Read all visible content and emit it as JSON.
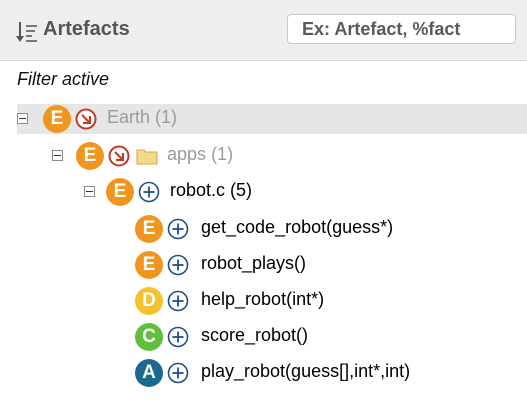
{
  "header": {
    "title": "Artefacts",
    "search_placeholder": "Ex: Artefact, %fact"
  },
  "filter_status": "Filter active",
  "tree": {
    "earth": {
      "badge": "E",
      "name": "Earth",
      "count": "(1)"
    },
    "apps": {
      "badge": "E",
      "name": "apps",
      "count": "(1)"
    },
    "robot": {
      "badge": "E",
      "name": "robot.c",
      "count": "(5)"
    },
    "functions": [
      {
        "badge": "E",
        "name": "get_code_robot(guess*)"
      },
      {
        "badge": "E",
        "name": "robot_plays()"
      },
      {
        "badge": "D",
        "name": "help_robot(int*)"
      },
      {
        "badge": "C",
        "name": "score_robot()"
      },
      {
        "badge": "A",
        "name": "play_robot(guess[],int*,int)"
      }
    ]
  },
  "colors": {
    "grade_E": "#f0961e",
    "grade_D": "#f5c22e",
    "grade_C": "#62bf3e",
    "grade_A": "#1a6a8e",
    "drill_down": "#c0392b",
    "expand": "#1e4e8c",
    "folder": "#f5d98a"
  },
  "icons": {
    "sort": "sort-descending-icon",
    "drill_down": "arrow-down-right-icon",
    "expand": "plus-circle-icon",
    "folder": "folder-icon"
  }
}
